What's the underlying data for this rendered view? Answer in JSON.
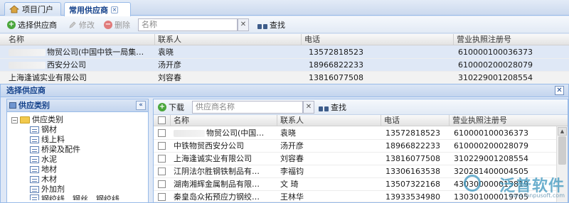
{
  "tabs": [
    {
      "label": "项目门户"
    },
    {
      "label": "常用供应商"
    }
  ],
  "toolbar": {
    "select_label": "选择供应商",
    "edit_label": "修改",
    "delete_label": "删除",
    "search_placeholder": "名称",
    "search_label": "查找"
  },
  "main_grid": {
    "columns": [
      "名称",
      "联系人",
      "电话",
      "营业执照注册号"
    ],
    "rows": [
      {
        "name": "物贸公司(中国中铁一局集…",
        "contact": "袁晓",
        "phone": "13572818523",
        "license": "610000100036373"
      },
      {
        "name": "西安分公司",
        "contact": "汤开彦",
        "phone": "18966822233",
        "license": "610000200028079"
      },
      {
        "name": "上海逢诚实业有限公司",
        "contact": "刘容春",
        "phone": "13816077508",
        "license": "310229001208554"
      }
    ]
  },
  "dialog": {
    "title": "选择供应商",
    "left_panel_title": "供应类别",
    "tree": {
      "root": "供应类别",
      "children": [
        "钢材",
        "线上料",
        "桥梁及配件",
        "水泥",
        "地材",
        "木材",
        "外加剂",
        "钢绞线、钢丝、钢绞线"
      ]
    },
    "right_toolbar": {
      "download_label": "下载",
      "search_placeholder": "供应商名称",
      "search_label": "查找"
    },
    "grid": {
      "columns": [
        "名称",
        "联系人",
        "电话",
        "营业执照注册号"
      ],
      "rows": [
        {
          "name": "物贸公司(中国…",
          "contact": "袁晓",
          "phone": "13572818523",
          "license": "610000100036373"
        },
        {
          "name": "中铁物贸西安分公司",
          "contact": "汤开彦",
          "phone": "18966822233",
          "license": "610000200028079"
        },
        {
          "name": "上海逢诚实业有限公司",
          "contact": "刘容春",
          "phone": "13816077508",
          "license": "310229001208554"
        },
        {
          "name": "江阴法尔胜钢铁制品有…",
          "contact": "李福钧",
          "phone": "13306163538",
          "license": "320281400004505"
        },
        {
          "name": "湖南湘辉金属制品有限…",
          "contact": "文 琦",
          "phone": "13507322168",
          "license": "430300000013819"
        },
        {
          "name": "秦皇岛众拓预应力钢绞…",
          "contact": "王林华",
          "phone": "13933534980",
          "license": "130301000019705"
        }
      ]
    }
  },
  "watermark": {
    "text": "泛普软件",
    "url": "www.fanpusoft.com"
  }
}
